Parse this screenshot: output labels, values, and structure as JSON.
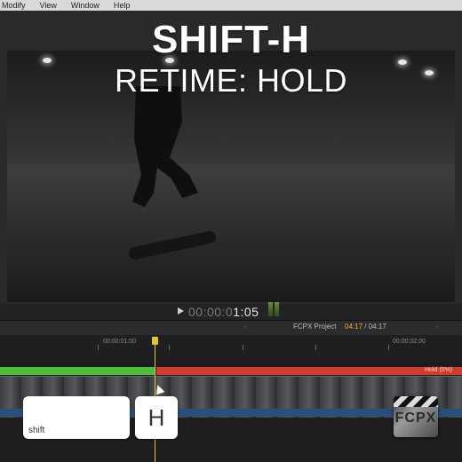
{
  "menu": {
    "items": [
      "Modify",
      "View",
      "Window",
      "Help"
    ]
  },
  "overlay": {
    "title": "SHIFT-H",
    "subtitle": "RETIME: HOLD"
  },
  "viewer": {
    "timecode_dim": "00:00:0",
    "timecode_bright": "1:05"
  },
  "timeline": {
    "project_name": "FCPX Project",
    "current_time": "04:17",
    "total_time": "/ 04:17",
    "ruler_labels": [
      "00:00:01:00",
      "00:00:02:00"
    ],
    "hold_label": "Hold (0%)"
  },
  "keys": {
    "shift_label": "shift",
    "h_label": "H"
  },
  "logo": {
    "text": "FCPX"
  },
  "colors": {
    "retime_normal": "#4fbb3c",
    "retime_hold": "#cf3d2e",
    "playhead": "#e2c531",
    "timecode_accent": "#f2b233"
  }
}
